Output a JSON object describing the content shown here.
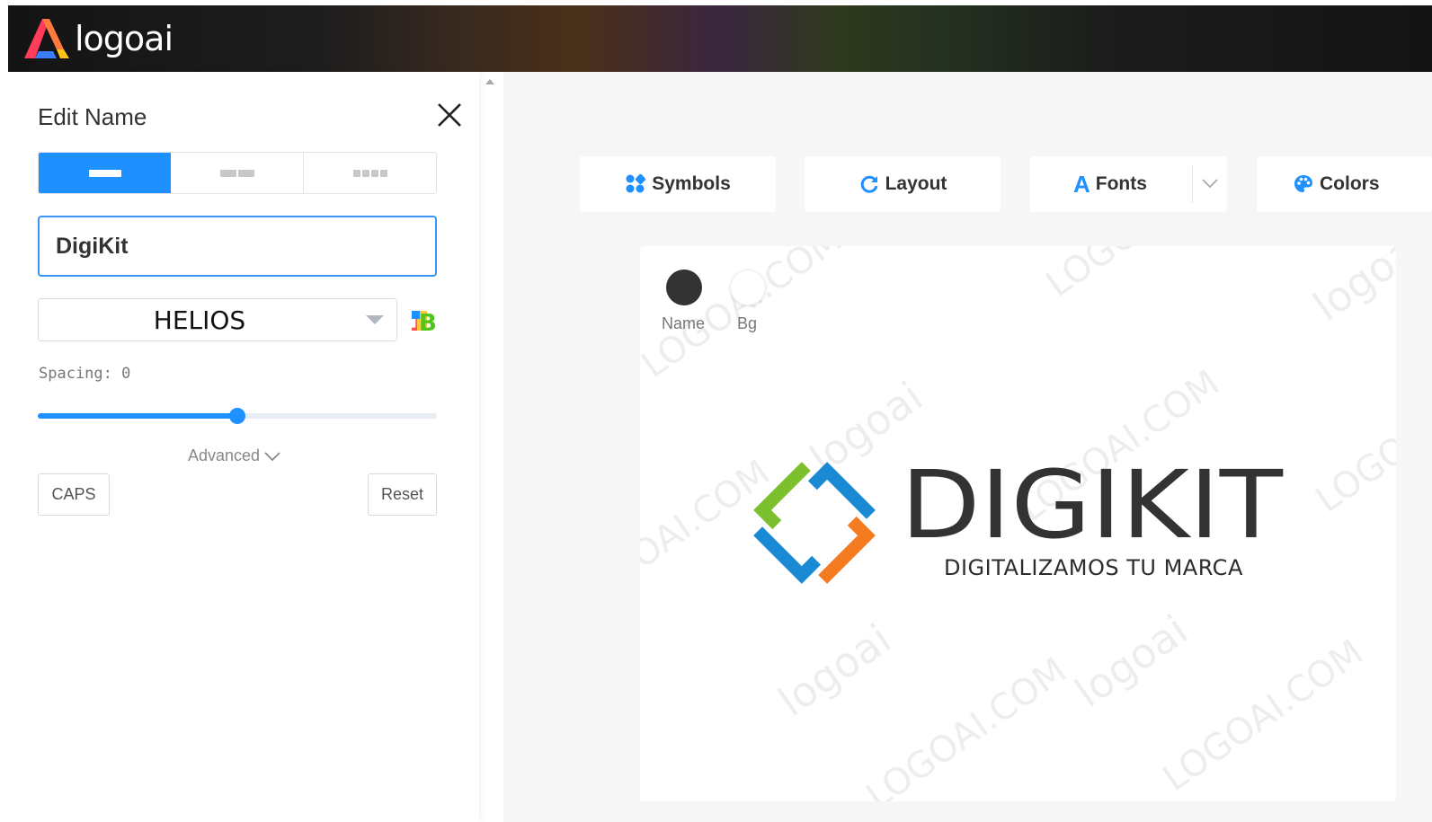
{
  "app": {
    "brand": "logoai"
  },
  "panel": {
    "title": "Edit Name",
    "name_value": "DigiKit",
    "font_name": "HELIOS",
    "spacing_label": "Spacing: 0",
    "spacing_value": 0,
    "slider_fraction": 0.5,
    "advanced_label": "Advanced",
    "caps_label": "CAPS",
    "reset_label": "Reset",
    "active_layout_tab": 0
  },
  "toolbar": {
    "symbols": "Symbols",
    "layout": "Layout",
    "fonts": "Fonts",
    "colors": "Colors"
  },
  "canvas": {
    "swatch_name_label": "Name",
    "swatch_bg_label": "Bg",
    "name_color": "#333333",
    "bg_color": "#ffffff",
    "logo_text": "DIGIKIT",
    "tagline": "DIGITALIZAMOS TU MARCA",
    "symbol_colors": {
      "green": "#7cbf2f",
      "blue": "#1a8ad4",
      "orange": "#f47b20"
    },
    "watermarks": [
      "LOGOAI.COM",
      "logoai",
      "LOGOAI.COM",
      "logoai",
      "LOGOAI.COM",
      "logoai",
      "LOGOAI.COM",
      "logoai"
    ]
  },
  "colors": {
    "accent": "#1e90ff",
    "text": "#333333"
  }
}
